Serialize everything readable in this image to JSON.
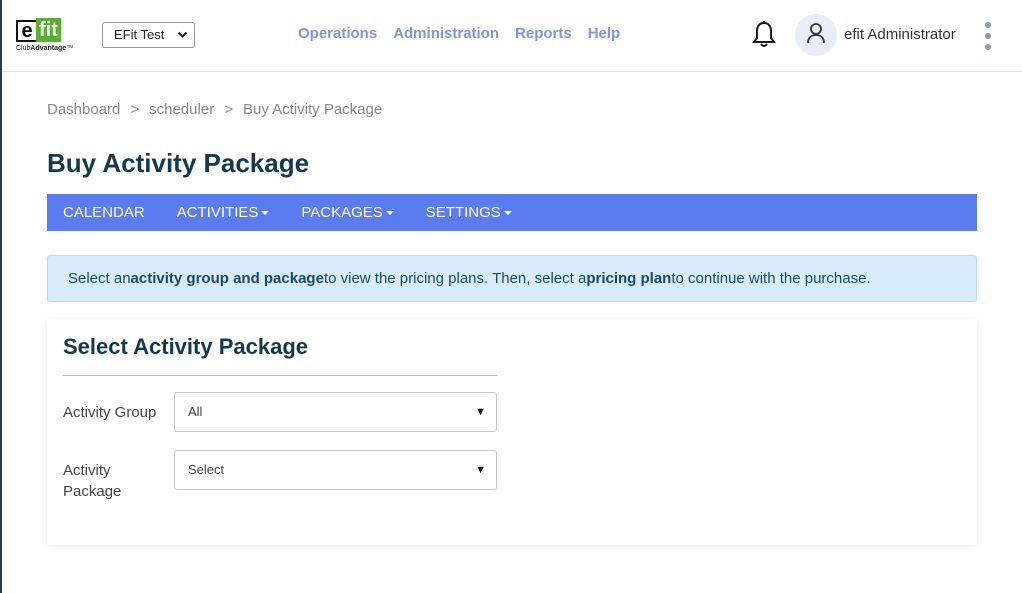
{
  "brand": {
    "logo_e": "e",
    "logo_fit": "fit",
    "logo_sub_a": "Club",
    "logo_sub_b": "Advantage",
    "logo_tm": "™"
  },
  "header": {
    "club_select_value": "EFit Test",
    "nav": [
      "Operations",
      "Administration",
      "Reports",
      "Help"
    ],
    "username": "efit Administrator"
  },
  "breadcrumb": {
    "items": [
      "Dashboard",
      "scheduler",
      "Buy Activity Package"
    ],
    "separator": ">"
  },
  "page": {
    "title": "Buy Activity Package"
  },
  "subnav": {
    "items": [
      {
        "label": "CALENDAR",
        "dropdown": false
      },
      {
        "label": "ACTIVITIES",
        "dropdown": true
      },
      {
        "label": "PACKAGES",
        "dropdown": true
      },
      {
        "label": "SETTINGS",
        "dropdown": true
      }
    ]
  },
  "info": {
    "t1": "Select an ",
    "b1": "activity group and package",
    "t2": " to view the pricing plans. Then, select a ",
    "b2": "pricing plan",
    "t3": " to continue with the purchase."
  },
  "card": {
    "title": "Select Activity Package",
    "activity_group_label": "Activity Group",
    "activity_group_value": "All",
    "activity_package_label_1": "Activity",
    "activity_package_label_2": "Package",
    "activity_package_value": "Select"
  },
  "colors": {
    "brand_green": "#5ab031",
    "nav_link": "#7c97e6",
    "subnav_bg": "#5b7bf0",
    "title": "#13394f",
    "info_bg": "#d6ecf8"
  },
  "icons": {
    "bell": "bell-icon",
    "avatar": "user-icon",
    "menu": "kebab-menu-icon"
  }
}
